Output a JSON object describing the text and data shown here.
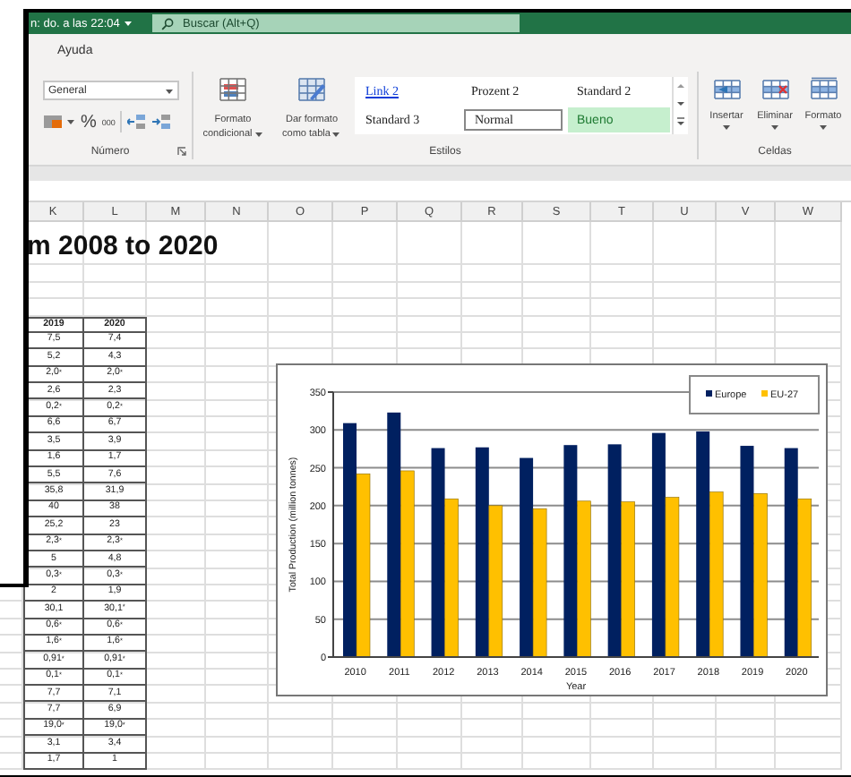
{
  "title_bar": {
    "text": "n: do. a las 22:04",
    "search": {
      "placeholder": "Buscar (Alt+Q)"
    }
  },
  "ribbon_tabs": [
    {
      "label": "Ayuda",
      "selected": false
    }
  ],
  "ribbon": {
    "number_group": {
      "format": "General",
      "percent": "%",
      "thousands": "000",
      "label": "Número"
    },
    "styles_group": {
      "label": "Estilos",
      "commands": [
        {
          "line1": "Formato",
          "line2": "condicional"
        },
        {
          "line1": "Dar formato",
          "line2": "como tabla"
        }
      ],
      "styles": [
        {
          "label": "Link 2",
          "kind": "link"
        },
        {
          "label": "Prozent 2",
          "kind": "plain"
        },
        {
          "label": "Standard 2",
          "kind": "plain"
        },
        {
          "label": "Standard 3",
          "kind": "plain"
        },
        {
          "label": "Normal",
          "kind": "normal"
        },
        {
          "label": "Bueno",
          "kind": "good"
        }
      ]
    },
    "cells_group": {
      "label": "Celdas",
      "commands": [
        "Insertar",
        "Eliminar",
        "Formato"
      ]
    }
  },
  "sheet": {
    "columns": [
      "K",
      "L",
      "M",
      "N",
      "O",
      "P",
      "Q",
      "R",
      "S",
      "T",
      "U",
      "V",
      "W"
    ],
    "title": "m 2008 to 2020",
    "table": {
      "header": [
        "2019",
        "2020"
      ],
      "rows": [
        [
          "7,5",
          "7,4"
        ],
        [
          "5,2",
          "4,3"
        ],
        [
          "2,0$^{*}$",
          "2,0$^{*}$"
        ],
        [
          "2,6",
          "2,3"
        ],
        [
          "0,2$^{*}$",
          "0,2$^{*}$"
        ],
        [
          "6,6",
          "6,7"
        ],
        [
          "3,5",
          "3,9"
        ],
        [
          "1,6",
          "1,7"
        ],
        [
          "5,5",
          "7,6"
        ],
        [
          "35,8",
          "31,9"
        ],
        [
          "40",
          "38"
        ],
        [
          "25,2",
          "23"
        ],
        [
          "2,3$^{*}$",
          "2,3$^{*}$"
        ],
        [
          "5",
          "4,8"
        ],
        [
          "0,3$^{*}$",
          "0,3$^{*}$"
        ],
        [
          "2",
          "1,9"
        ],
        [
          "30,1",
          "30,1$^{*}$"
        ],
        [
          "0,6$^{*}$",
          "0,6$^{*}$"
        ],
        [
          "1,6$^{*}$",
          "1,6$^{*}$"
        ],
        [
          "0,91$^{*}$",
          "0,91$^{*}$"
        ],
        [
          "0,1$^{*}$",
          "0,1$^{*}$"
        ],
        [
          "7,7",
          "7,1"
        ],
        [
          "7,7",
          "6,9"
        ],
        [
          "19,0$^{*}$",
          "19,0$^{*}$"
        ],
        [
          "3,1",
          "3,4"
        ],
        [
          "1,7",
          "1"
        ]
      ]
    },
    "chart": {
      "chart_data": {
        "type": "bar",
        "xlabel": "Year",
        "ylabel": "Total Production (million tonnes)",
        "categories": [
          "2010",
          "2011",
          "2012",
          "2013",
          "2014",
          "2015",
          "2016",
          "2017",
          "2018",
          "2019",
          "2020"
        ],
        "series": [
          {
            "name": "Europe",
            "color": "#002060",
            "values": [
              309,
              323,
              276,
              277,
              263,
              280,
              281,
              296,
              298,
              279,
              276
            ]
          },
          {
            "name": "EU-27",
            "color": "#ffc000",
            "values": [
              242,
              246,
              209,
              200,
              196,
              206,
              205,
              211,
              218,
              216,
              209
            ]
          }
        ],
        "grid": true,
        "legend": true,
        "ylim": [
          0,
          350
        ],
        "yticks": [
          0,
          50,
          100,
          150,
          200,
          250,
          300,
          350
        ]
      }
    }
  }
}
